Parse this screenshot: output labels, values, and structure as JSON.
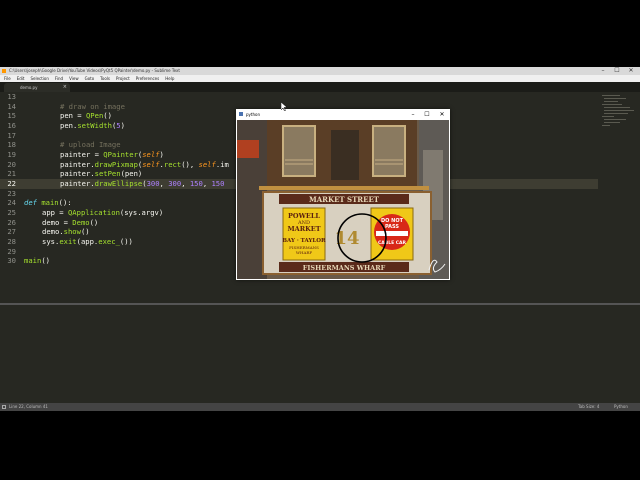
{
  "sublime": {
    "title": "C:\\Users\\joseph\\Google Drive\\YouTube Videos\\PyQt5 QPainter\\demo.py - Sublime Text",
    "menu": [
      "File",
      "Edit",
      "Selection",
      "Find",
      "View",
      "Goto",
      "Tools",
      "Project",
      "Preferences",
      "Help"
    ],
    "tab": "demo.py",
    "status_left": "Line 22, Column 41",
    "status_tab": "Tab Size: 4",
    "status_lang": "Python"
  },
  "code": {
    "line_numbers": [
      "13",
      "14",
      "15",
      "16",
      "17",
      "18",
      "19",
      "20",
      "21",
      "22",
      "23",
      "24",
      "25",
      "26",
      "27",
      "28",
      "29",
      "30"
    ],
    "current_line": "22",
    "l13": "",
    "l14": "# draw on image",
    "l15a": "pen = ",
    "l15b": "QPen",
    "l15c": "()",
    "l16a": "pen.",
    "l16b": "setWidth",
    "l16c": "(",
    "l16d": "5",
    "l16e": ")",
    "l17": "",
    "l18": "# upload Image",
    "l19a": "painter = ",
    "l19b": "QPainter",
    "l19c": "(",
    "l19d": "self",
    "l19e": ")",
    "l20a": "painter.",
    "l20b": "drawPixmap",
    "l20c": "(",
    "l20d": "self",
    "l20e": ".",
    "l20f": "rect",
    "l20g": "(), ",
    "l20h": "self",
    "l20i": ".im",
    "l21a": "painter.",
    "l21b": "setPen",
    "l21c": "(pen)",
    "l22a": "painter.",
    "l22b": "drawEllipse",
    "l22c": "(",
    "l22d": "300",
    "l22e": ", ",
    "l22f": "300",
    "l22g": ", ",
    "l22h": "150",
    "l22i": ", ",
    "l22j": "150",
    "l24a": "def",
    "l24b": "main",
    "l24c": "():",
    "l25a": "app = ",
    "l25b": "QApplication",
    "l25c": "(sys.argv)",
    "l26a": "demo = ",
    "l26b": "Demo",
    "l26c": "()",
    "l27a": "demo.",
    "l27b": "show",
    "l27c": "()",
    "l28a": "sys.",
    "l28b": "exit",
    "l28c": "(app.",
    "l28d": "exec_",
    "l28e": "())",
    "l30a": "main",
    "l30b": "()"
  },
  "pywindow": {
    "title": "python",
    "minimize": "–",
    "maximize": "☐",
    "close": "✕",
    "image": {
      "top_sign": "MARKET STREET",
      "yellow_sign_1": "POWELL",
      "yellow_sign_2": "AND",
      "yellow_sign_3": "MARKET",
      "yellow_sign_4": "BAY · TAYLOR",
      "yellow_sign_5": "FISHERMANS",
      "yellow_sign_6": "WHARF",
      "car_number": "14",
      "red_sign_1": "DO NOT",
      "red_sign_2": "PASS",
      "red_sign_3": "CABLE CAR",
      "bottom_sign": "FISHERMANS WHARF"
    }
  },
  "colors": {
    "editor_bg": "#272822",
    "comment": "#75715e",
    "keyword": "#f92672",
    "function": "#a6e22e",
    "number": "#ae81ff"
  }
}
